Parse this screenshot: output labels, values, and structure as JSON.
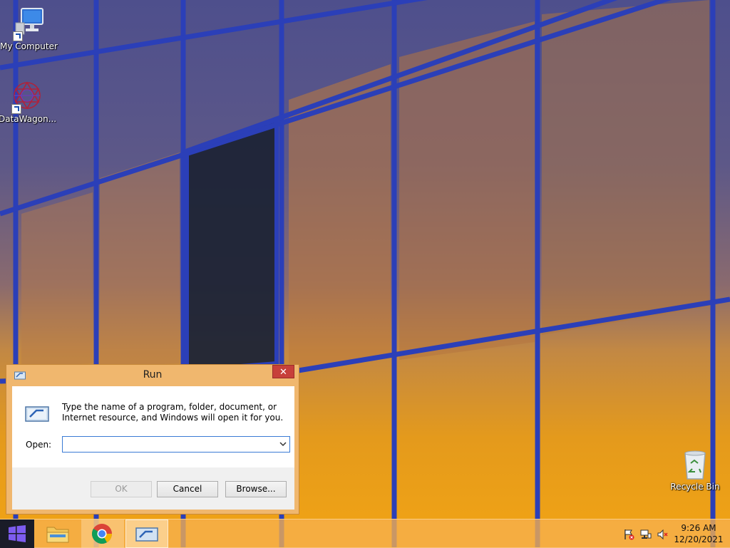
{
  "desktop": {
    "icons": [
      {
        "label": "My Computer",
        "icon": "computer-icon"
      },
      {
        "label": "DataWagon...",
        "icon": "datawagon-icon"
      },
      {
        "label": "Recycle Bin",
        "icon": "recycle-bin-icon"
      }
    ]
  },
  "run_dialog": {
    "title": "Run",
    "close_glyph": "✕",
    "description": "Type the name of a program, folder, document, or Internet resource, and Windows will open it for you.",
    "open_label": "Open:",
    "open_value": "",
    "ok_label": "OK",
    "cancel_label": "Cancel",
    "browse_label": "Browse...",
    "icon": "run-icon"
  },
  "taskbar": {
    "items": [
      {
        "name": "start-button",
        "icon": "windows-logo-icon"
      },
      {
        "name": "file-explorer",
        "icon": "folder-icon"
      },
      {
        "name": "chrome",
        "icon": "chrome-icon"
      },
      {
        "name": "run",
        "icon": "run-icon"
      }
    ],
    "tray": {
      "icons": [
        "action-center-flag-icon",
        "network-icon",
        "volume-muted-icon"
      ],
      "time": "9:26 AM",
      "date": "12/20/2021"
    }
  },
  "colors": {
    "close_button": "#c7403a",
    "dialog_frame": "#f0b76e",
    "input_border": "#3a7bd5"
  }
}
